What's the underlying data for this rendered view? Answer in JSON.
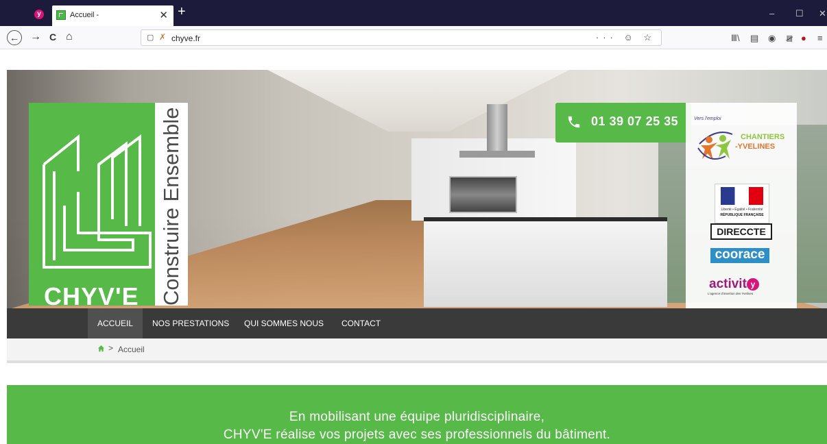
{
  "browser": {
    "tab": {
      "title": "Accueil -",
      "close_glyph": "✕"
    },
    "app_icon_letter": "y",
    "new_tab_glyph": "+",
    "window_controls": [
      "–",
      "☐",
      "✕"
    ],
    "nav": {
      "back": "←",
      "forward": "→",
      "reload": "C",
      "home": "⌂"
    },
    "url": {
      "shield": "▢",
      "lock": "✗",
      "text": "chyve.fr",
      "actions": "··· ☺ ☆"
    },
    "toolbar_icons": [
      "library-icon",
      "sidebar-icon",
      "account-icon",
      "columns-icon",
      "ublock-icon",
      "menu-icon"
    ],
    "toolbar_glyphs": [
      "Ⅲ\\",
      "▤",
      "◉",
      "𝍸",
      "●",
      "≡"
    ]
  },
  "header": {
    "logo": {
      "name": "CHYV'E",
      "tagline": "Construire Ensemble"
    },
    "phone": "01 39 07 25 35",
    "partners": {
      "chantiers_small": "Vers l'emploi",
      "chantiers_line1": "CHANTIERS",
      "chantiers_line2": "-YVELINES",
      "devise": "Liberté • Égalité • Fraternité",
      "republique": "RÉPUBLIQUE FRANÇAISE",
      "direccte": "DIRECCTE",
      "coorace": "coorace",
      "activity": "activit",
      "activity_y": "y",
      "activity_sub": "L'agence d'insertion des Yvelines"
    }
  },
  "menu": {
    "items": [
      "ACCUEIL",
      "NOS PRESTATIONS",
      "QUI SOMMES NOUS",
      "CONTACT"
    ],
    "active_index": 0
  },
  "breadcrumb": {
    "separator": ">",
    "current": "Accueil"
  },
  "band": {
    "line1": "En mobilisant une équipe pluridisciplinaire,",
    "line2": "CHYV'E réalise vos projets avec ses professionnels du bâtiment."
  },
  "colors": {
    "brand_green": "#56b948",
    "menu_bg": "#3a3a3a",
    "tabbar_bg": "#1c1b3b"
  }
}
